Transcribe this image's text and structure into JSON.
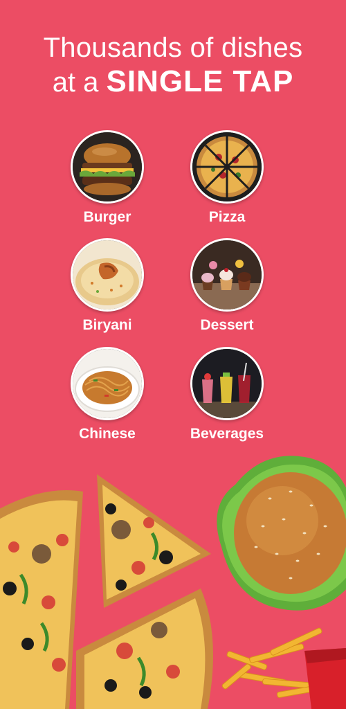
{
  "headline": {
    "line1": "Thousands of dishes",
    "line2_prefix": "at a",
    "line2_emphasis": "SINGLE TAP"
  },
  "categories": [
    {
      "label": "Burger",
      "icon": "burger-photo"
    },
    {
      "label": "Pizza",
      "icon": "pizza-photo"
    },
    {
      "label": "Biryani",
      "icon": "biryani-photo"
    },
    {
      "label": "Dessert",
      "icon": "dessert-photo"
    },
    {
      "label": "Chinese",
      "icon": "noodles-photo"
    },
    {
      "label": "Beverages",
      "icon": "drinks-photo"
    }
  ],
  "colors": {
    "background": "#ec4d64",
    "text": "#ffffff"
  }
}
